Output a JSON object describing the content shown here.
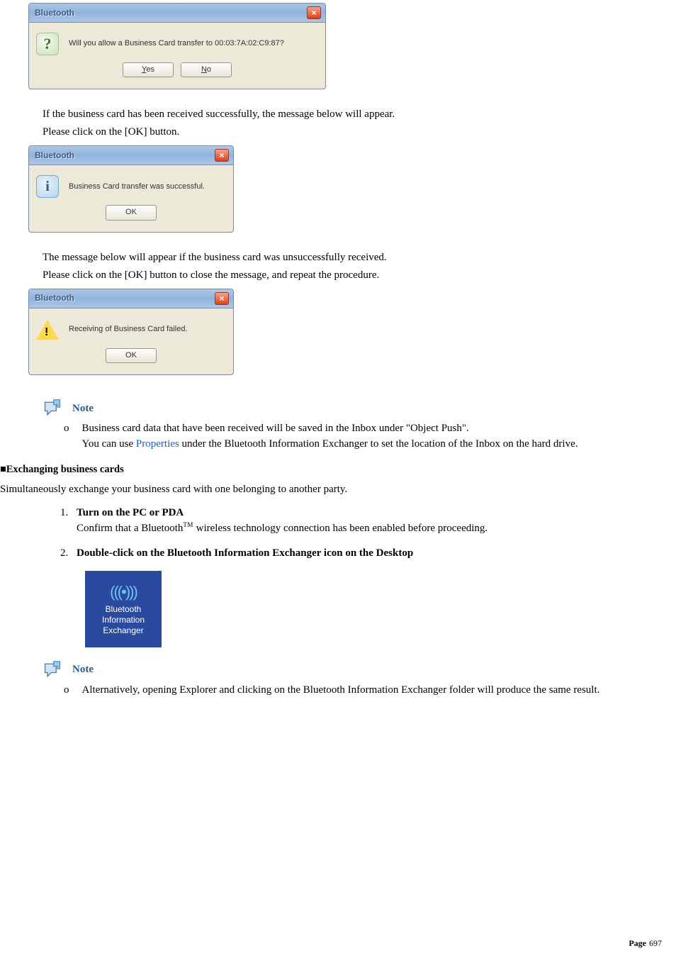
{
  "dialog1": {
    "title": "Bluetooth",
    "close": "×",
    "message": "Will you allow a Business Card transfer to 00:03:7A:02:C9:87?",
    "yes_pre": "Y",
    "yes_rest": "es",
    "no_pre": "N",
    "no_rest": "o"
  },
  "para1a": "If the business card has been received successfully, the message below will appear.",
  "para1b": "Please click on the [OK] button.",
  "dialog2": {
    "title": "Bluetooth",
    "close": "×",
    "message": "Business Card transfer was successful.",
    "ok": "OK"
  },
  "para2a": "The message below will appear if the business card was unsuccessfully received.",
  "para2b": "Please click on the [OK] button to close the message, and repeat the procedure.",
  "dialog3": {
    "title": "Bluetooth",
    "close": "×",
    "message": "Receiving of Business Card failed.",
    "ok": "OK"
  },
  "note_label": "Note",
  "note1_marker": "o",
  "note1_a": "Business card data that have been received will be saved in the Inbox under \"Object Push\".",
  "note1_b_pre": "You can use ",
  "note1_b_link": "Properties",
  "note1_b_post": " under the Bluetooth Information Exchanger to set the location of the Inbox on the hard drive.",
  "section2": {
    "prefix": "■",
    "title": "Exchanging business cards"
  },
  "section2_body": "Simultaneously exchange your business card with one belonging to another party.",
  "step1": {
    "title": "Turn on the PC or PDA",
    "body_pre": "Confirm that a Bluetooth",
    "tm": "TM",
    "body_post": " wireless technology connection has been enabled before proceeding."
  },
  "step2": {
    "title": "Double-click on the Bluetooth Information Exchanger icon on the Desktop"
  },
  "desktop_icon": {
    "glyph": "(((•)))",
    "line1": "Bluetooth",
    "line2": "Information",
    "line3": "Exchanger"
  },
  "note2_marker": "o",
  "note2_text": "Alternatively, opening Explorer and clicking on the Bluetooth Information Exchanger folder will produce the same result.",
  "page": {
    "label": "Page",
    "num": "697"
  }
}
